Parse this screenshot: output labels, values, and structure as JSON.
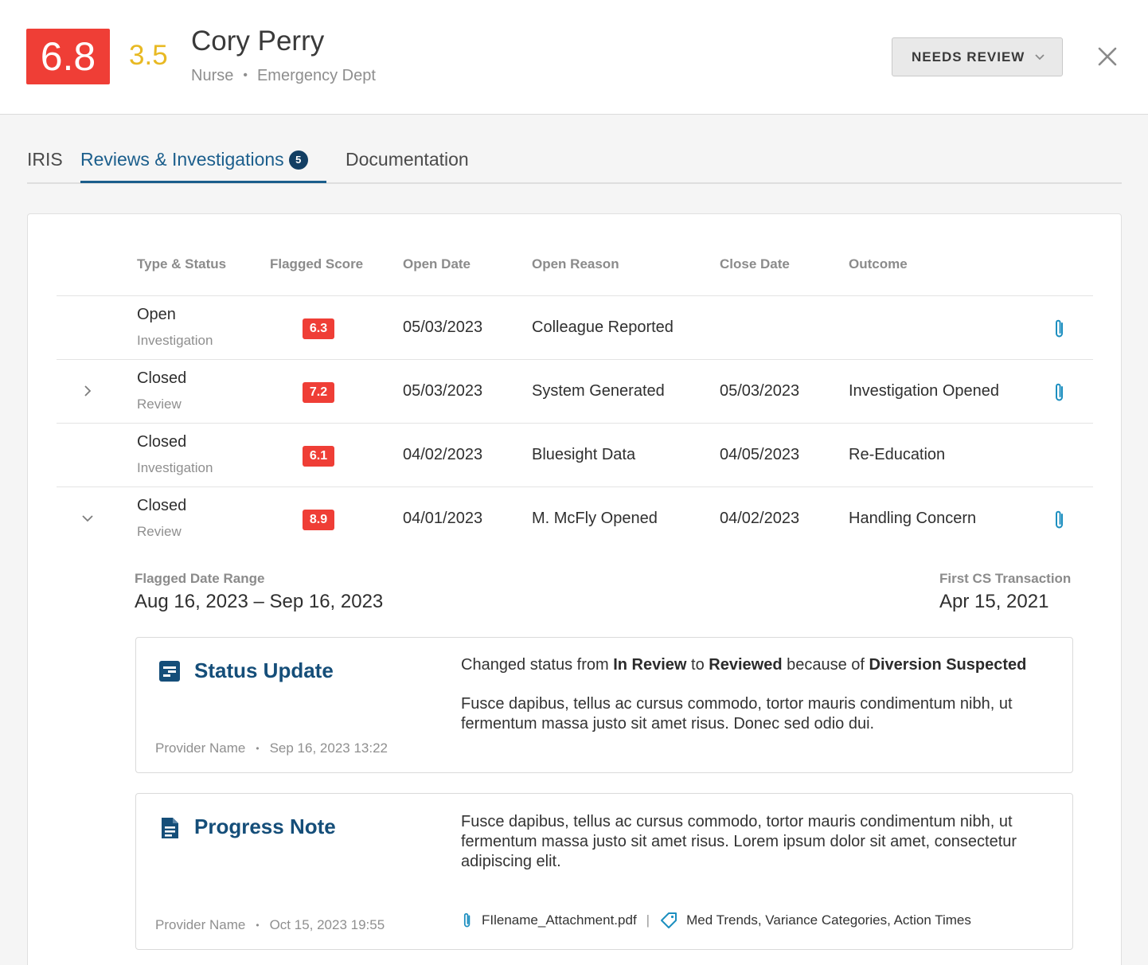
{
  "header": {
    "score_main": "6.8",
    "score_secondary": "3.5",
    "name": "Cory Perry",
    "role": "Nurse",
    "department": "Emergency Dept",
    "status_dropdown": "NEEDS REVIEW",
    "colors": {
      "score_main": "#ef3e36",
      "score_secondary": "#e8b923"
    }
  },
  "tabs": [
    {
      "label": "IRIS"
    },
    {
      "label": "Reviews & Investigations",
      "badge": "5"
    },
    {
      "label": "Documentation"
    }
  ],
  "table": {
    "columns": [
      "Type & Status",
      "Flagged Score",
      "Open Date",
      "Open Reason",
      "Close Date",
      "Outcome"
    ],
    "rows": [
      {
        "status": "Open",
        "type": "Investigation",
        "score": "6.3",
        "open_date": "05/03/2023",
        "open_reason": "Colleague Reported",
        "close_date": "",
        "outcome": ""
      },
      {
        "status": "Closed",
        "type": "Review",
        "score": "7.2",
        "open_date": "05/03/2023",
        "open_reason": "System Generated",
        "close_date": "05/03/2023",
        "outcome": "Investigation Opened"
      },
      {
        "status": "Closed",
        "type": "Investigation",
        "score": "6.1",
        "open_date": "04/02/2023",
        "open_reason": "Bluesight Data",
        "close_date": "04/05/2023",
        "outcome": "Re-Education"
      },
      {
        "status": "Closed",
        "type": "Review",
        "score": "8.9",
        "open_date": "04/01/2023",
        "open_reason": "M. McFly Opened",
        "close_date": "04/02/2023",
        "outcome": "Handling Concern"
      }
    ]
  },
  "details": {
    "range_label": "Flagged Date Range",
    "range_value": "Aug 16, 2023 – Sep 16, 2023",
    "first_cs_label": "First CS Transaction",
    "first_cs_value": "Apr 15, 2021"
  },
  "notes": [
    {
      "title": "Status Update",
      "provider": "Provider Name",
      "timestamp": "Sep 16, 2023 13:22",
      "change_prefix": "Changed status from ",
      "from_status": "In Review",
      "change_mid": " to ",
      "to_status": "Reviewed",
      "change_suffix": " because of ",
      "reason": "Diversion Suspected",
      "body": "Fusce dapibus, tellus ac cursus commodo, tortor mauris condimentum nibh, ut fermentum massa justo sit amet risus. Donec sed odio dui."
    },
    {
      "title": "Progress Note",
      "provider": "Provider Name",
      "timestamp": "Oct 15, 2023 19:55",
      "body": "Fusce dapibus, tellus ac cursus commodo, tortor mauris condimentum nibh, ut fermentum massa justo sit amet risus. Lorem ipsum dolor sit amet, consectetur adipiscing elit.",
      "attachment": "FIlename_Attachment.pdf",
      "tags": "Med Trends, Variance Categories, Action Times"
    }
  ],
  "icons": {
    "close": "close-icon",
    "chevron": "chevron-down-icon",
    "attachment": "paperclip-icon",
    "status_update": "status-update-icon",
    "progress_note": "document-icon",
    "tag": "tag-icon"
  }
}
